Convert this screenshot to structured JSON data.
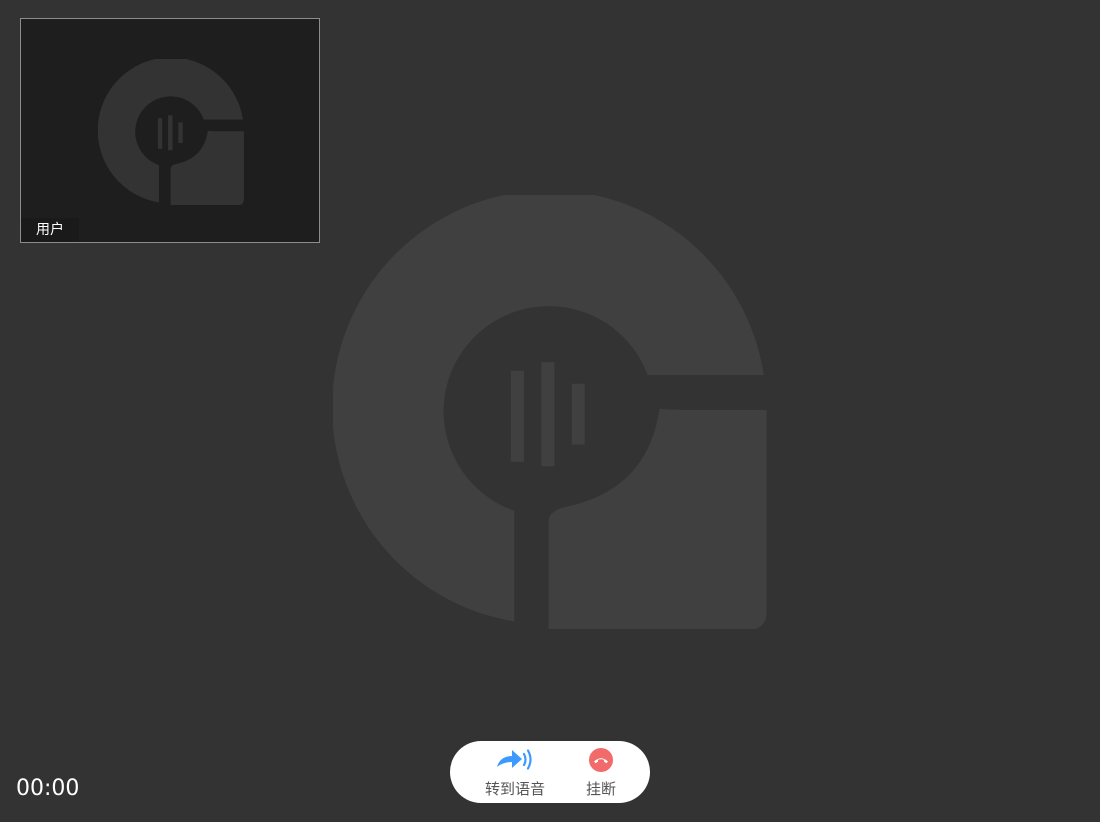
{
  "pip": {
    "label": "用户"
  },
  "call": {
    "timer": "00:00"
  },
  "controls": {
    "switch_voice_label": "转到语音",
    "switch_voice_icon": "switch-to-voice-icon",
    "hangup_label": "挂断",
    "hangup_icon": "hangup-icon"
  },
  "colors": {
    "background": "#333333",
    "pip_background": "#1e1e1e",
    "accent_blue": "#3c9aff",
    "hangup_red": "#f26b6b"
  }
}
